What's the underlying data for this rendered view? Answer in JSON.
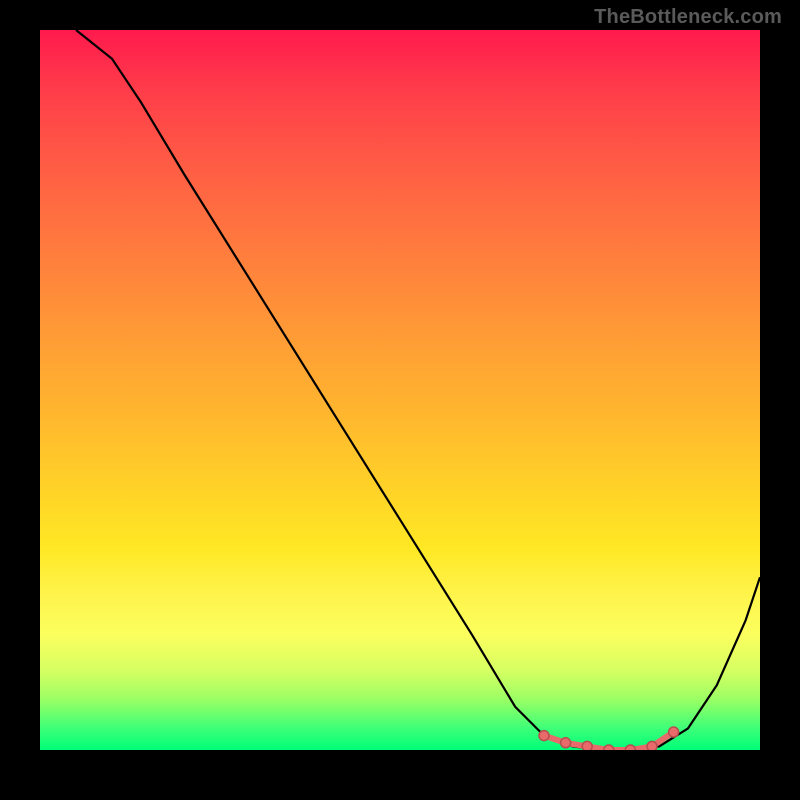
{
  "watermark": "TheBottleneck.com",
  "chart_data": {
    "type": "line",
    "title": "",
    "xlabel": "",
    "ylabel": "",
    "xlim": [
      0,
      100
    ],
    "ylim": [
      0,
      100
    ],
    "grid": false,
    "legend": false,
    "series": [
      {
        "name": "curve",
        "x": [
          5,
          10,
          14,
          20,
          30,
          40,
          50,
          60,
          66,
          70,
          74,
          78,
          82,
          86,
          90,
          94,
          98,
          100
        ],
        "y": [
          100,
          96,
          90,
          80,
          64,
          48,
          32,
          16,
          6,
          2,
          0.5,
          0,
          0,
          0.5,
          3,
          9,
          18,
          24
        ]
      }
    ],
    "highlight": {
      "name": "optimal-region",
      "x": [
        70,
        73,
        76,
        79,
        82,
        85,
        88
      ],
      "y": [
        2,
        1,
        0.5,
        0,
        0,
        0.5,
        2.5
      ]
    },
    "colors": {
      "top": "#ff1a4d",
      "mid": "#ffd327",
      "bottom": "#00ff79",
      "curve": "#000000",
      "highlight": "#e86a6a"
    }
  }
}
